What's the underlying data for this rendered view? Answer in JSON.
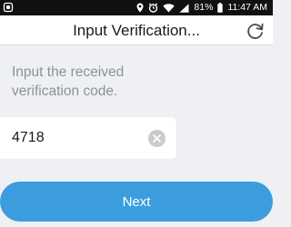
{
  "status_bar": {
    "battery_percent": "81%",
    "time": "11:47 AM",
    "icons": [
      "location-pin-icon",
      "alarm-icon",
      "wifi-icon",
      "signal-icon",
      "battery-icon"
    ]
  },
  "header": {
    "title": "Input Verification...",
    "refresh_icon": "refresh-icon"
  },
  "instruction": {
    "text": "Input the received verification code."
  },
  "code_input": {
    "value": "4718",
    "clear_icon": "clear-icon"
  },
  "next_button": {
    "label": "Next"
  },
  "colors": {
    "accent": "#3b9ddd",
    "background": "#eef0f3",
    "status_bar": "#111111",
    "instruction_text": "#8e9196"
  }
}
